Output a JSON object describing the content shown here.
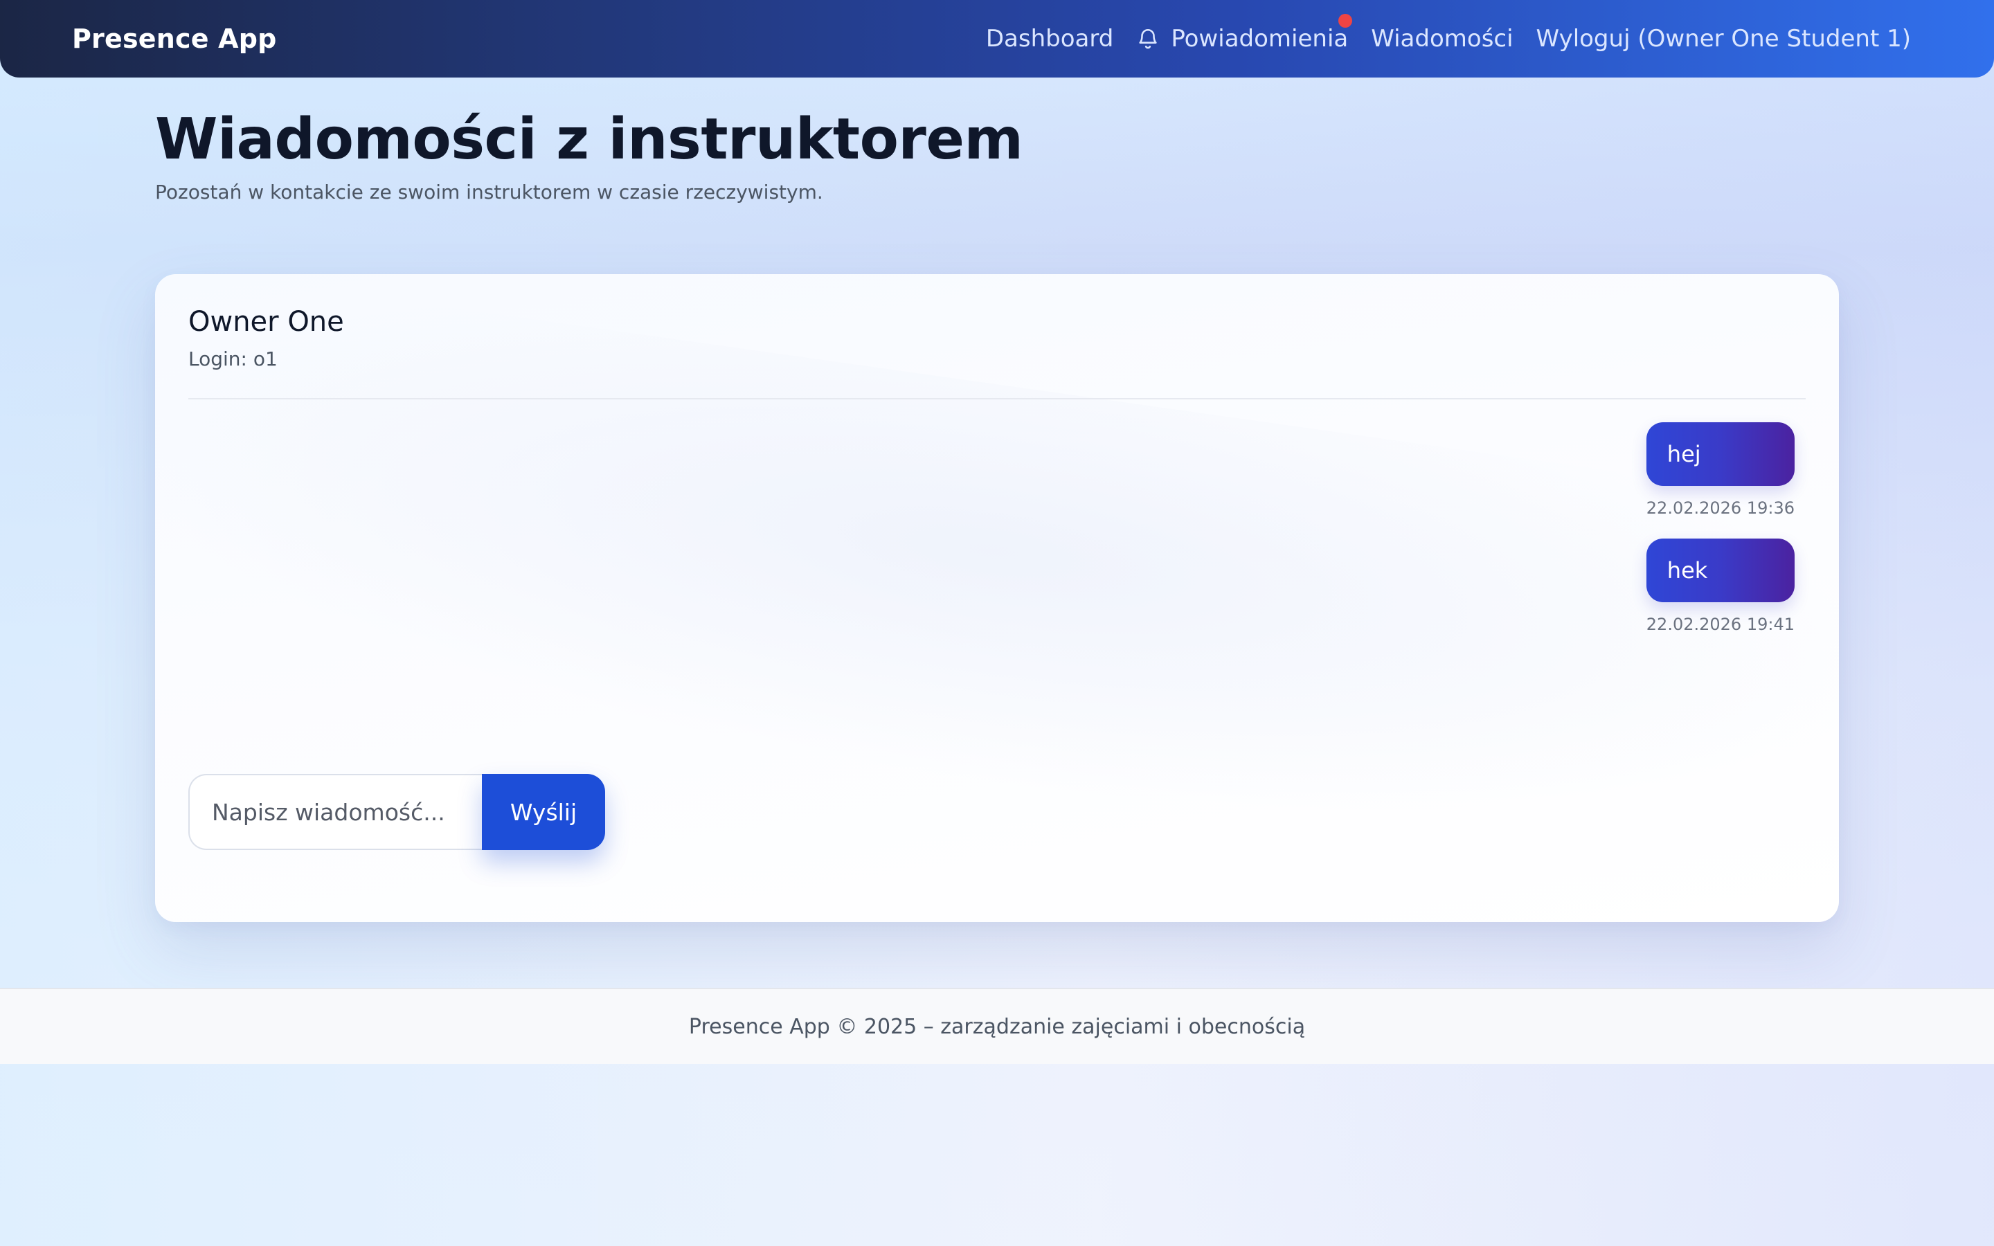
{
  "navbar": {
    "brand": "Presence App",
    "links": {
      "dashboard": "Dashboard",
      "notifications": "Powiadomienia",
      "messages": "Wiadomości",
      "logout": "Wyloguj (Owner One Student 1)"
    },
    "notification_indicator_color": "#ef4444",
    "icons": {
      "notifications": "bell-icon"
    }
  },
  "header": {
    "title": "Wiadomości z instruktorem",
    "subtitle": "Pozostań w kontakcie ze swoim instruktorem w czasie rzeczywistym."
  },
  "conversation": {
    "contact_name": "Owner One",
    "contact_login": "Login: o1",
    "messages": [
      {
        "text": "hej",
        "time": "22.02.2026 19:36"
      },
      {
        "text": "hek",
        "time": "22.02.2026 19:41"
      }
    ]
  },
  "composer": {
    "placeholder": "Napisz wiadomość...",
    "value": "",
    "send_label": "Wyślij"
  },
  "footer": {
    "text": "Presence App © 2025 – zarządzanie zajęciami i obecnością"
  },
  "colors": {
    "accent": "#1d4ed8",
    "bubble_start": "#2f46d6",
    "bubble_end": "#4b22a0"
  }
}
